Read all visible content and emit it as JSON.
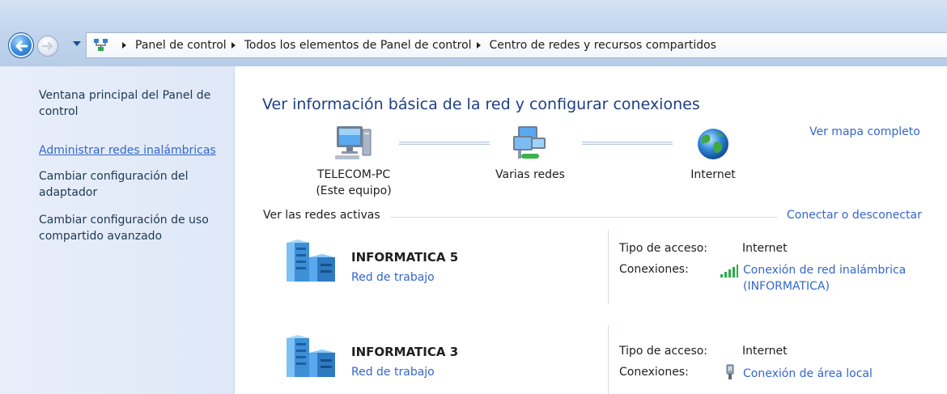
{
  "breadcrumb": {
    "items": [
      "Panel de control",
      "Todos los elementos de Panel de control",
      "Centro de redes y recursos compartidos"
    ]
  },
  "sidebar": {
    "items": [
      {
        "label": "Ventana principal del Panel de control",
        "active": false
      },
      {
        "label": "Administrar redes inalámbricas",
        "active": true
      },
      {
        "label": "Cambiar configuración del adaptador",
        "active": false
      },
      {
        "label": "Cambiar configuración de uso compartido avanzado",
        "active": false
      }
    ]
  },
  "main": {
    "title": "Ver información básica de la red y configurar conexiones",
    "full_map_link": "Ver mapa completo",
    "map_nodes": [
      {
        "label": "TELECOM-PC",
        "sublabel": "(Este equipo)",
        "icon": "computer-icon"
      },
      {
        "label": "Varias redes",
        "icon": "multiple-networks-icon"
      },
      {
        "label": "Internet",
        "icon": "globe-icon"
      }
    ],
    "active_networks_label": "Ver las redes activas",
    "connect_link": "Conectar o desconectar",
    "networks": [
      {
        "name": "INFORMATICA 5",
        "type": "Red de trabajo",
        "access_label": "Tipo de acceso:",
        "access_value": "Internet",
        "connections_label": "Conexiones:",
        "connection": "Conexión de red inalámbrica",
        "connection_detail": "(INFORMATICA)",
        "connection_icon": "wifi-signal-icon"
      },
      {
        "name": "INFORMATICA 3",
        "type": "Red de trabajo",
        "access_label": "Tipo de acceso:",
        "access_value": "Internet",
        "connections_label": "Conexiones:",
        "connection": "Conexión de área local",
        "connection_icon": "ethernet-plug-icon"
      }
    ]
  },
  "colors": {
    "link": "#3366cc",
    "title": "#1e3f84",
    "sidebar_bg": "#e3ebf8"
  }
}
